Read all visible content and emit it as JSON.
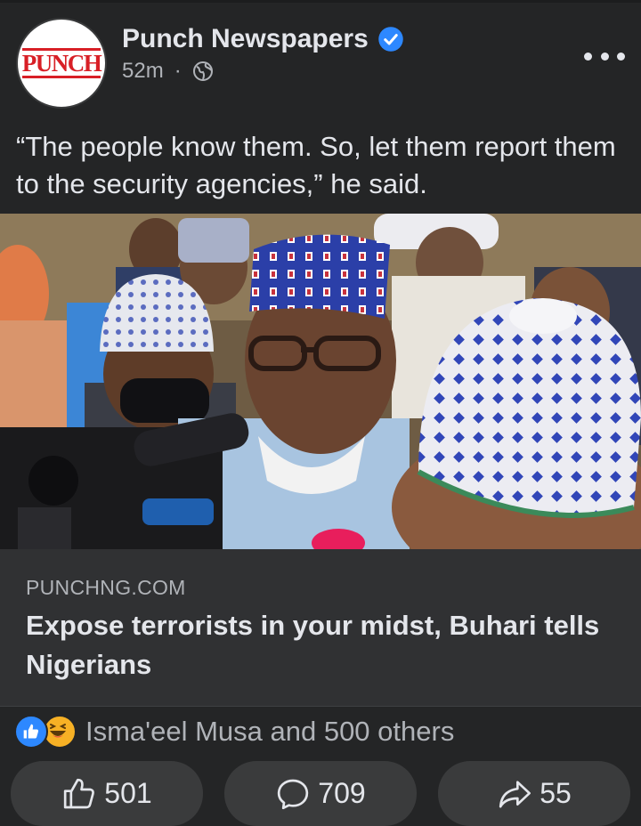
{
  "post": {
    "page_name": "Punch Newspapers",
    "avatar_text": "PUNCH",
    "time": "52m",
    "separator": "·",
    "caption": "“The people know them. So, let them report them to the security agencies,” he said."
  },
  "link": {
    "domain": "PUNCHNG.COM",
    "headline": "Expose terrorists in your midst, Buhari tells Nigerians"
  },
  "reactions": {
    "summary": "Isma'eel Musa and 500 others",
    "icons": [
      "like-icon",
      "haha-icon"
    ]
  },
  "actions": {
    "like_count": "501",
    "comment_count": "709",
    "share_count": "55"
  },
  "colors": {
    "background": "#242526",
    "link_box": "#303133",
    "accent_blue": "#2d88ff",
    "brand_red": "#d81f26"
  }
}
